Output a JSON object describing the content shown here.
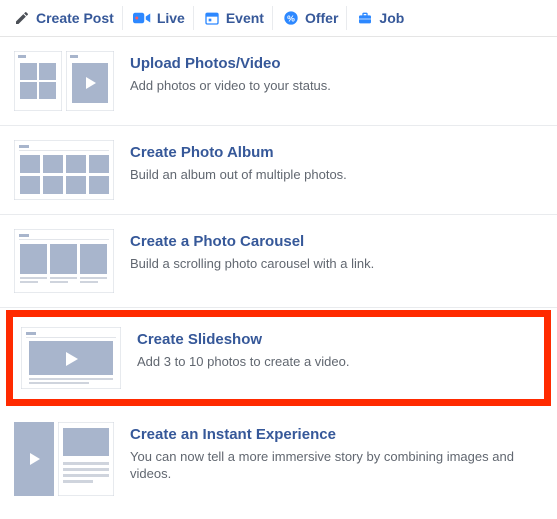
{
  "topbar": {
    "create_post": "Create Post",
    "live": "Live",
    "event": "Event",
    "offer": "Offer",
    "job": "Job"
  },
  "options": {
    "upload": {
      "title": "Upload Photos/Video",
      "desc": "Add photos or video to your status."
    },
    "album": {
      "title": "Create Photo Album",
      "desc": "Build an album out of multiple photos."
    },
    "carousel": {
      "title": "Create a Photo Carousel",
      "desc": "Build a scrolling photo carousel with a link."
    },
    "slideshow": {
      "title": "Create Slideshow",
      "desc": "Add 3 to 10 photos to create a video."
    },
    "instant": {
      "title": "Create an Instant Experience",
      "desc": "You can now tell a more immersive story by combining images and videos."
    }
  },
  "colors": {
    "link": "#365899",
    "muted": "#616770",
    "icon": "#2d88ff",
    "thumb": "#a8b5cc",
    "highlight": "#ff2a00"
  }
}
